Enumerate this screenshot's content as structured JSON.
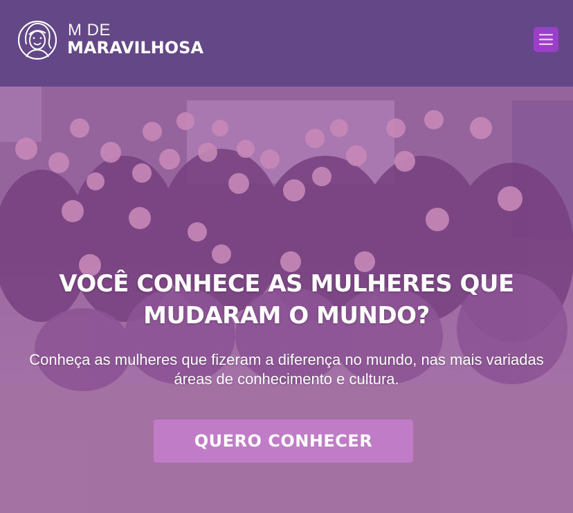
{
  "brand": {
    "logo_top": "M DE",
    "logo_bottom": "MARAVILHOSA",
    "logo_icon": "woman-face-icon"
  },
  "header": {
    "menu_icon": "hamburger-menu-icon"
  },
  "hero": {
    "title": "VOCÊ CONHECE AS MULHERES QUE MUDARAM O MUNDO?",
    "subtitle": "Conheça as mulheres que fizeram a diferença no mundo, nas mais variadas áreas de conhecimento e cultura.",
    "cta_label": "QUERO CONHECER"
  },
  "colors": {
    "header_bg": "#634786",
    "menu_button": "#9b3fc9",
    "overlay": "#a046aa",
    "cta_bg": "#c07cc6",
    "text": "#ffffff"
  }
}
